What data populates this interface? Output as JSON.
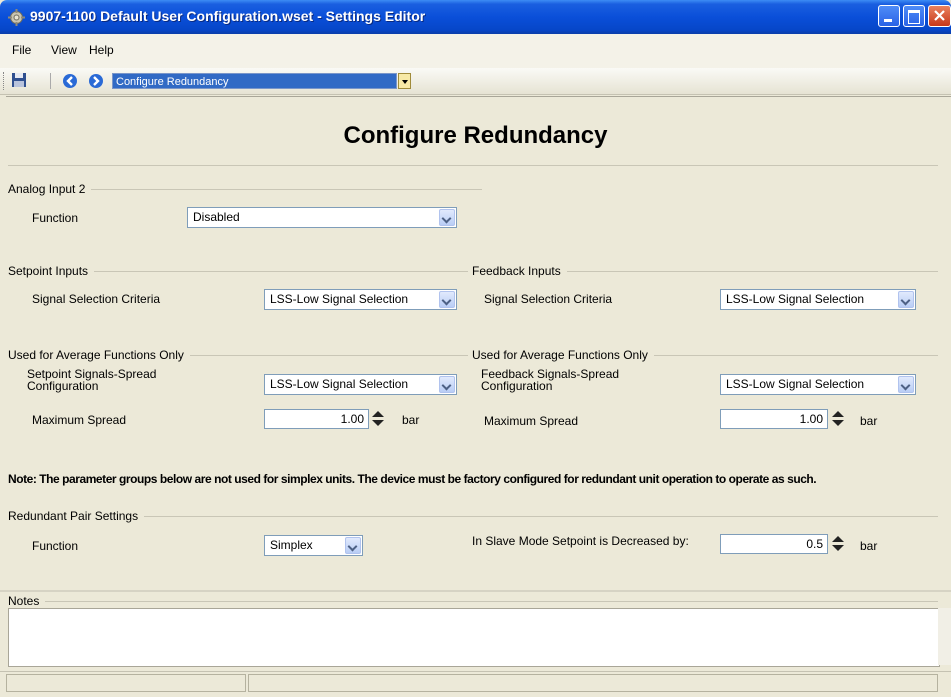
{
  "window": {
    "title": "9907-1100 Default User Configuration.wset - Settings Editor"
  },
  "menu": [
    "File",
    "View",
    "Help"
  ],
  "toolbar": {
    "page_selected": "Configure Redundancy"
  },
  "page": {
    "heading": "Configure Redundancy"
  },
  "analog_input_2": {
    "group": "Analog Input 2",
    "function_label": "Function",
    "function_value": "Disabled"
  },
  "setpoint_inputs": {
    "group": "Setpoint Inputs",
    "criteria_label": "Signal Selection Criteria",
    "criteria_value": "LSS-Low Signal Selection"
  },
  "feedback_inputs": {
    "group": "Feedback Inputs",
    "criteria_label": "Signal Selection Criteria",
    "criteria_value": "LSS-Low Signal Selection"
  },
  "avg_setpoint": {
    "group": "Used for Average Functions Only",
    "spread_label": "Setpoint Signals-Spread Configuration",
    "spread_value": "LSS-Low Signal Selection",
    "max_spread_label": "Maximum Spread",
    "max_spread_value": "1.00",
    "unit": "bar"
  },
  "avg_feedback": {
    "group": "Used for Average Functions Only",
    "spread_label": "Feedback Signals-Spread Configuration",
    "spread_value": "LSS-Low Signal Selection",
    "max_spread_label": "Maximum Spread",
    "max_spread_value": "1.00",
    "unit": "bar"
  },
  "note": "Note: The parameter groups below are not used for simplex units. The device must be factory configured for redundant unit operation to operate as such.",
  "redundant_pair": {
    "group": "Redundant Pair Settings",
    "function_label": "Function",
    "function_value": "Simplex",
    "slave_label": "In Slave Mode Setpoint is Decreased by:",
    "slave_value": "0.5",
    "unit": "bar"
  },
  "notes": {
    "label": "Notes"
  }
}
